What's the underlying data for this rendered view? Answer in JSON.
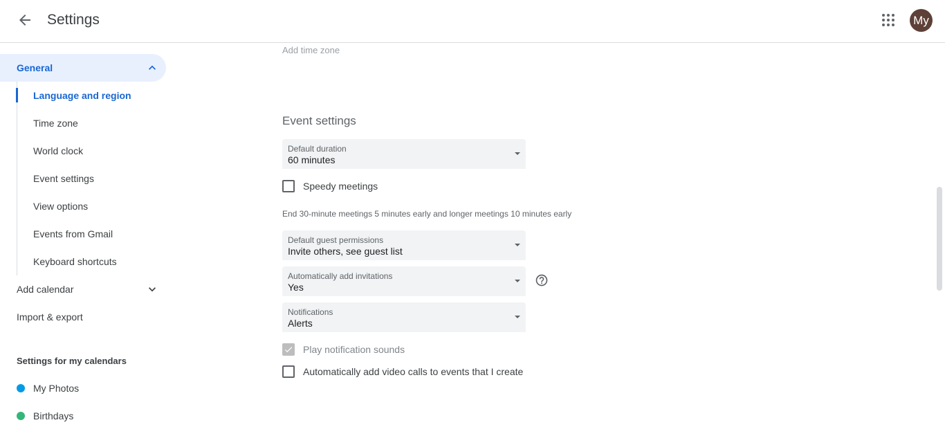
{
  "header": {
    "title": "Settings",
    "avatar_initials": "My",
    "avatar_color": "#5d4037"
  },
  "sidebar": {
    "general": "General",
    "sub_items": [
      {
        "label": "Language and region",
        "active": true
      },
      {
        "label": "Time zone"
      },
      {
        "label": "World clock"
      },
      {
        "label": "Event settings"
      },
      {
        "label": "View options"
      },
      {
        "label": "Events from Gmail"
      },
      {
        "label": "Keyboard shortcuts"
      }
    ],
    "add_calendar": "Add calendar",
    "import_export": "Import & export",
    "my_calendars_heading": "Settings for my calendars",
    "calendars": [
      {
        "label": "My Photos",
        "color": "#039be5"
      },
      {
        "label": "Birthdays",
        "color": "#33b679"
      }
    ]
  },
  "main": {
    "add_time_zone": "Add time zone",
    "event_settings_title": "Event settings",
    "default_duration": {
      "label": "Default duration",
      "value": "60 minutes"
    },
    "speedy_meetings": "Speedy meetings",
    "speedy_hint": "End 30-minute meetings 5 minutes early and longer meetings 10 minutes early",
    "guest_permissions": {
      "label": "Default guest permissions",
      "value": "Invite others, see guest list"
    },
    "add_invitations": {
      "label": "Automatically add invitations",
      "value": "Yes"
    },
    "notifications": {
      "label": "Notifications",
      "value": "Alerts"
    },
    "play_sounds": "Play notification sounds",
    "video_calls": "Automatically add video calls to events that I create"
  },
  "colors": {
    "accent": "#1967d2",
    "selected_bg": "#e8f0fe"
  }
}
